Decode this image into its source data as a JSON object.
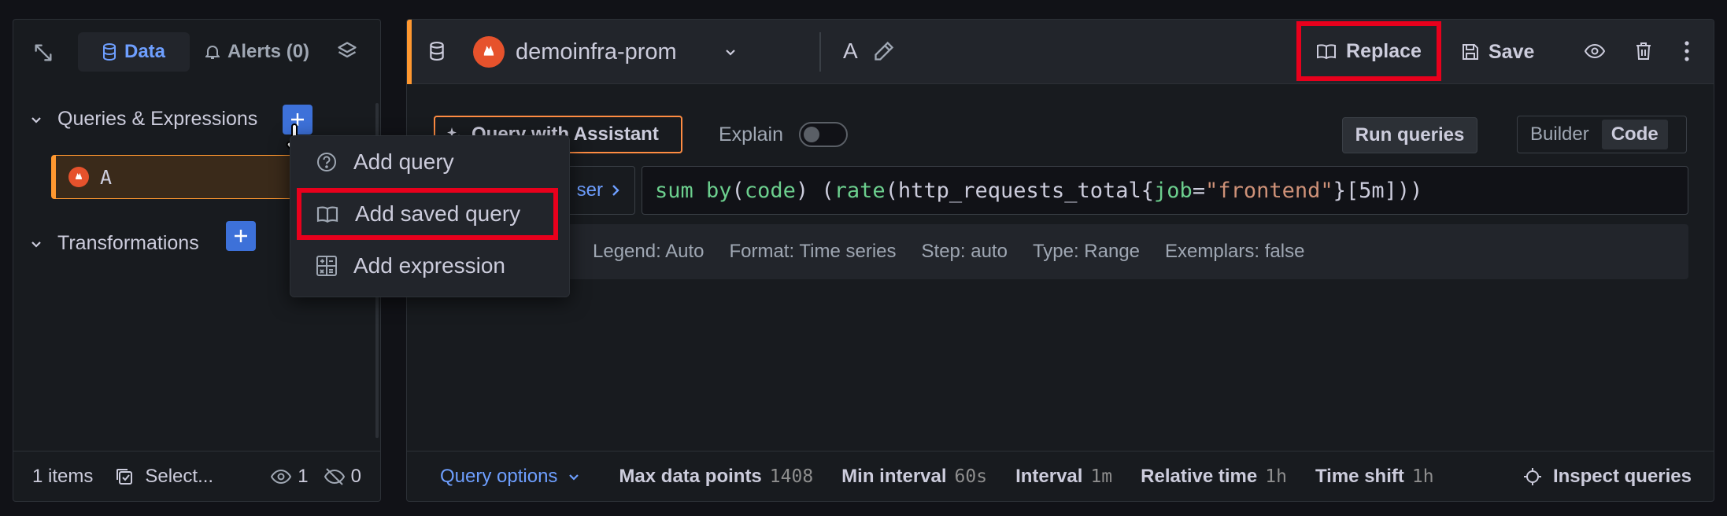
{
  "left": {
    "tabs": [
      {
        "label": "Data",
        "icon": "database-icon",
        "active": true
      },
      {
        "label": "Alerts (0)",
        "icon": "bell-icon",
        "active": false
      }
    ],
    "sections": {
      "queries_title": "Queries & Expressions",
      "transformations_title": "Transformations"
    },
    "query_item": {
      "label": "A"
    },
    "footer": {
      "items_count": "1 items",
      "select_label": "Select...",
      "visible_count": "1",
      "hidden_count": "0"
    }
  },
  "menu": {
    "items": [
      {
        "label": "Add query",
        "icon": "question-circle-icon"
      },
      {
        "label": "Add saved query",
        "icon": "book-open-icon",
        "highlighted": true
      },
      {
        "label": "Add expression",
        "icon": "calculator-icon"
      }
    ]
  },
  "header": {
    "datasource": "demoinfra-prom",
    "query_name": "A",
    "replace_label": "Replace",
    "save_label": "Save"
  },
  "editor": {
    "assistant_label": "Query with Assistant",
    "explain_label": "Explain",
    "run_label": "Run queries",
    "modes": [
      "Builder",
      "Code"
    ],
    "active_mode": "Code",
    "kb_label": "ser",
    "code": {
      "tokens": [
        {
          "t": "sum ",
          "c": "kw"
        },
        {
          "t": "by",
          "c": "kw"
        },
        {
          "t": "(",
          "c": "def"
        },
        {
          "t": "code",
          "c": "kw"
        },
        {
          "t": ") (",
          "c": "def"
        },
        {
          "t": "rate",
          "c": "kw"
        },
        {
          "t": "(http_requests_total{",
          "c": "def"
        },
        {
          "t": "job",
          "c": "kw"
        },
        {
          "t": "=",
          "c": "def"
        },
        {
          "t": "\"frontend\"",
          "c": "str"
        },
        {
          "t": "}[5m]))",
          "c": "def"
        }
      ]
    },
    "options_strip": [
      "Legend: Auto",
      "Format: Time series",
      "Step: auto",
      "Type: Range",
      "Exemplars: false"
    ]
  },
  "footer": {
    "query_options_label": "Query options",
    "max_data_points": {
      "label": "Max data points",
      "value": "1408"
    },
    "min_interval": {
      "label": "Min interval",
      "value": "60s"
    },
    "interval": {
      "label": "Interval",
      "value": "1m"
    },
    "relative_time": {
      "label": "Relative time",
      "value": "1h"
    },
    "time_shift": {
      "label": "Time shift",
      "value": "1h"
    },
    "inspect_label": "Inspect queries"
  },
  "colors": {
    "accent": "#3d71d9",
    "query_orange": "#ff9830",
    "highlight_red": "#e8001c",
    "prometheus": "#e6522c"
  }
}
